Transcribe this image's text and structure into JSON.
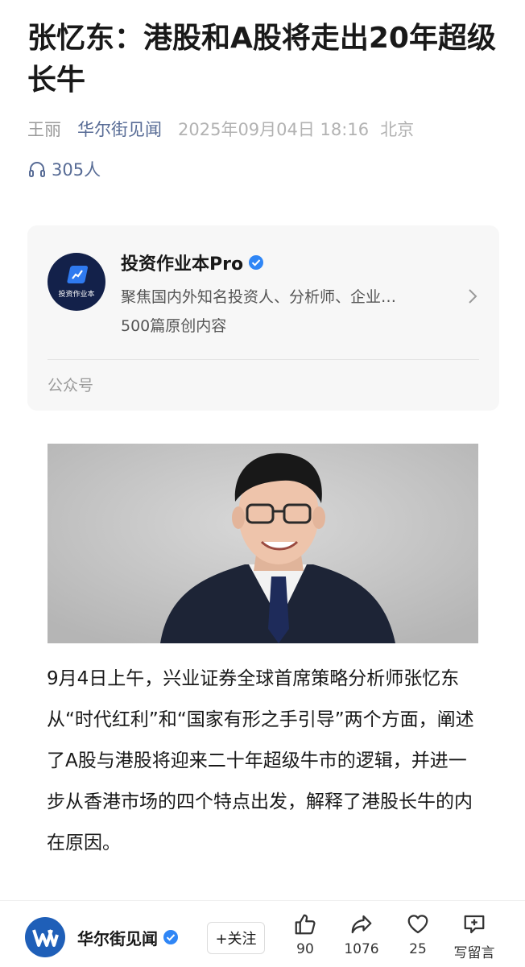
{
  "article": {
    "title": "张忆东：港股和A股将走出20年超级长牛",
    "author": "王丽",
    "source": "华尔街见闻",
    "date": "2025年09月04日 18:16",
    "location": "北京",
    "listeners": "305人",
    "body": "9月4日上午，兴业证券全球首席策略分析师张忆东从“时代红利”和“国家有形之手引导”两个方面，阐述了A股与港股将迎来二十年超级牛市的逻辑，并进一步从香港市场的四个特点出发，解释了港股长牛的内在原因。"
  },
  "account_card": {
    "logo_text": "投资作业本",
    "name": "投资作业本Pro",
    "description": "聚焦国内外知名投资人、分析师、企业…",
    "article_count": "500篇原创内容",
    "type": "公众号"
  },
  "bottom_bar": {
    "source_name": "华尔街见闻",
    "follow_label": "+关注",
    "like_count": "90",
    "share_count": "1076",
    "favorite_count": "25",
    "comment_label": "写留言"
  },
  "colors": {
    "link_blue": "#576b95",
    "verified_blue": "#2f86f6",
    "card_bg": "#f7f7f7"
  },
  "icons": [
    "headphones-icon",
    "verified-badge-icon",
    "chevron-right-icon",
    "thumbs-up-icon",
    "share-icon",
    "heart-icon",
    "comment-icon"
  ]
}
